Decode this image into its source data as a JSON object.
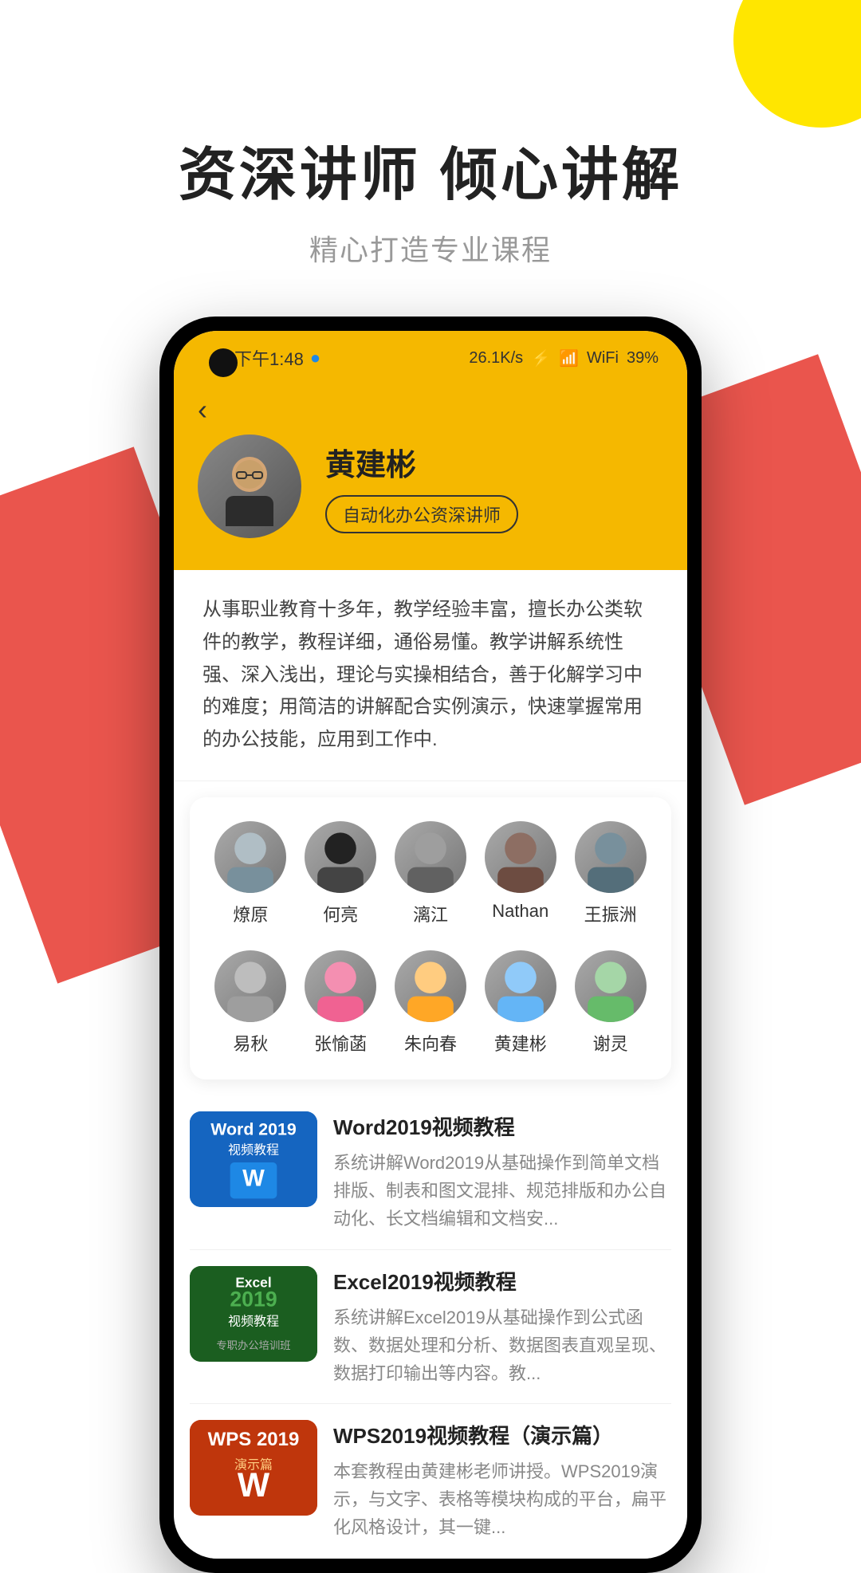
{
  "page": {
    "background_color": "#ffffff"
  },
  "decorations": {
    "circle_color": "#FFE600",
    "red_accent_color": "#E8423A"
  },
  "header": {
    "title": "资深讲师  倾心讲解",
    "subtitle": "精心打造专业课程"
  },
  "phone": {
    "status_bar": {
      "time": "下午1:48",
      "speed": "26.1K/s",
      "battery": "39%"
    },
    "instructor_profile": {
      "name": "黄建彬",
      "tag": "自动化办公资深讲师",
      "bio": "从事职业教育十多年，教学经验丰富，擅长办公类软件的教学，教程详细，通俗易懂。教学讲解系统性强、深入浅出，理论与实操相结合，善于化解学习中的难度；用简洁的讲解配合实例演示，快速掌握常用的办公技能，应用到工作中.",
      "back_label": "‹"
    },
    "instructors_row1": [
      {
        "name": "燎原",
        "id": "instructor-liaoyuan"
      },
      {
        "name": "何亮",
        "id": "instructor-heliang"
      },
      {
        "name": "漓江",
        "id": "instructor-lijiang"
      },
      {
        "name": "Nathan",
        "id": "instructor-nathan"
      },
      {
        "name": "王振洲",
        "id": "instructor-wangzhenzhou"
      }
    ],
    "instructors_row2": [
      {
        "name": "易秋",
        "id": "instructor-yiqiu"
      },
      {
        "name": "张愉菡",
        "id": "instructor-zhangyuhan"
      },
      {
        "name": "朱向春",
        "id": "instructor-zhuxiangchun"
      },
      {
        "name": "黄建彬",
        "id": "instructor-huangjianbin"
      },
      {
        "name": "谢灵",
        "id": "instructor-xieling"
      }
    ],
    "courses": [
      {
        "id": "course-word2019",
        "title": "Word2019视频教程",
        "desc": "系统讲解Word2019从基础操作到简单文档排版、制表和图文混排、规范排版和办公自动化、长文档编辑和文档安...",
        "thumb_type": "word",
        "thumb_label": "Word 2019\n视频教程"
      },
      {
        "id": "course-excel2019",
        "title": "Excel2019视频教程",
        "desc": "系统讲解Excel2019从基础操作到公式函数、数据处理和分析、数据图表直观呈现、数据打印输出等内容。教...",
        "thumb_type": "excel",
        "thumb_label": "Excel\n2019\n视频教程"
      },
      {
        "id": "course-wps2019",
        "title": "WPS2019视频教程（演示篇）",
        "desc": "本套教程由黄建彬老师讲授。WPS2019演示，与文字、表格等模块构成的平台，扁平化风格设计，其一键...",
        "thumb_type": "wps",
        "thumb_label": "WPS 2019\n演示篇"
      }
    ]
  }
}
